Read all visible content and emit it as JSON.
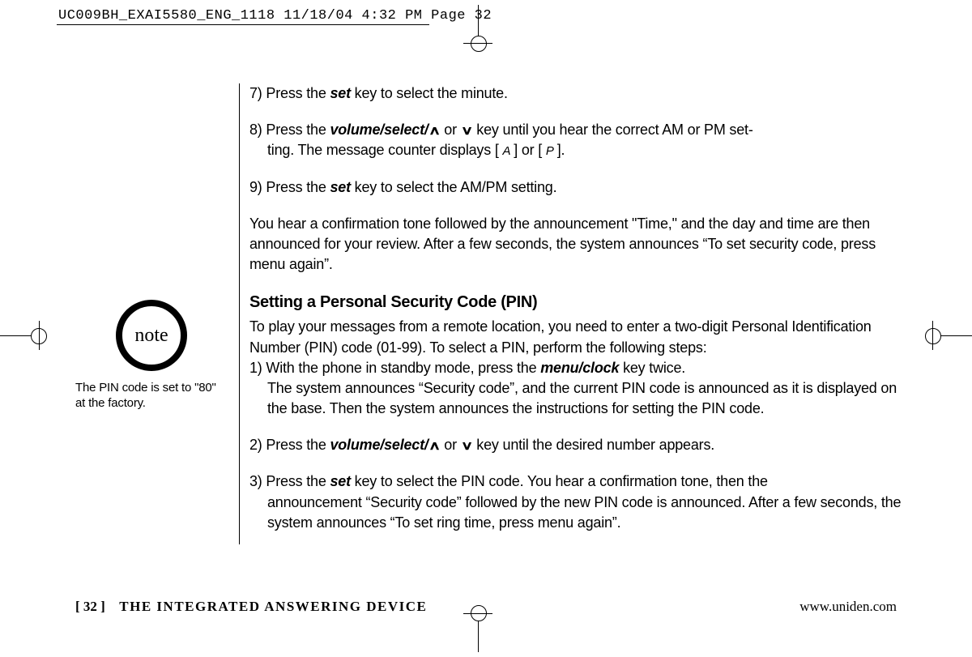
{
  "slug": "UC009BH_EXAI5580_ENG_1118  11/18/04  4:32 PM  Page 32",
  "sidebar": {
    "note_icon_label": "note",
    "note_text": "The PIN code is set to \"80\" at the factory."
  },
  "main": {
    "step7_a": "7) Press the ",
    "step7_key": "set",
    "step7_b": " key to select the minute.",
    "step8_a": "8) Press the ",
    "step8_key": "volume/select/",
    "step8_b": " or ",
    "step8_c": " key until you hear the correct AM or PM set-",
    "step8_indent_a": "ting. The message counter displays [ ",
    "step8_lcd_a": "A",
    "step8_indent_b": " ] or [ ",
    "step8_lcd_p": "P",
    "step8_indent_c": " ].",
    "step9_a": "9) Press the ",
    "step9_key": "set",
    "step9_b": " key to select the AM/PM setting.",
    "confirm_para": "You hear a confirmation tone followed by the announcement \"Time,\" and the day and time are then announced for your review. After a few seconds, the system announces “To set security code, press menu again”.",
    "heading_pin": "Setting a Personal Security Code (PIN)",
    "pin_intro": "To play your messages from a remote location, you need to enter a two-digit Personal Identification Number (PIN) code (01-99). To select a PIN, perform the following steps:",
    "pin1_a": "1) With the phone in standby mode, press the ",
    "pin1_key": "menu/clock",
    "pin1_b": " key twice.",
    "pin1_indent": "The system announces “Security code”, and the current PIN code is announced as it is displayed on the base. Then the system announces the instructions for setting the PIN code.",
    "pin2_a": "2) Press the ",
    "pin2_key": "volume/select/",
    "pin2_b": " or ",
    "pin2_c": " key until the desired number appears.",
    "pin3_a": "3) Press the ",
    "pin3_key": "set",
    "pin3_b": " key to select the PIN code. You hear a confirmation tone, then the",
    "pin3_indent": "announcement “Security code” followed by the new PIN code is announced. After a few seconds, the system announces “To set ring time, press menu again”."
  },
  "footer": {
    "page_number": "[ 32 ]",
    "section_title": "THE INTEGRATED ANSWERING DEVICE",
    "url": "www.uniden.com"
  },
  "glyphs": {
    "up": "∧",
    "down": "∨"
  }
}
